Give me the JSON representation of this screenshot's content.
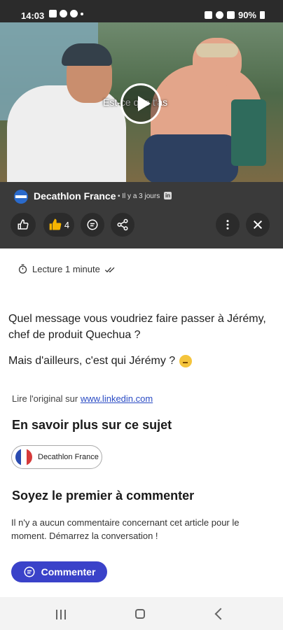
{
  "status_bar": {
    "time": "14:03",
    "battery": "90%"
  },
  "video": {
    "caption": "Est-ce que t'as"
  },
  "author": {
    "name": "Decathlon France",
    "time": "• Il y a 3 jours",
    "source_badge": "in"
  },
  "actions": {
    "reaction_count": "4"
  },
  "article": {
    "read_time": "Lecture 1 minute",
    "paragraph1": "Quel message vous voudriez faire passer à Jérémy, chef de produit Quechua ?",
    "paragraph2": "Mais d'ailleurs, c'est qui Jérémy ?",
    "original_prefix": "Lire l'original sur",
    "original_link": "www.linkedin.com"
  },
  "topics": {
    "title": "En savoir plus sur ce sujet",
    "chip_label": "Decathlon France"
  },
  "comments": {
    "title": "Soyez le premier à commenter",
    "empty_text": "Il n'y a aucun commentaire concernant cet article pour le moment. Démarrez la conversation !",
    "cta_label": "Commenter"
  },
  "colors": {
    "accent": "#3a42c9",
    "link": "#2a4bc4",
    "dark_bar": "#3a3a3a"
  }
}
